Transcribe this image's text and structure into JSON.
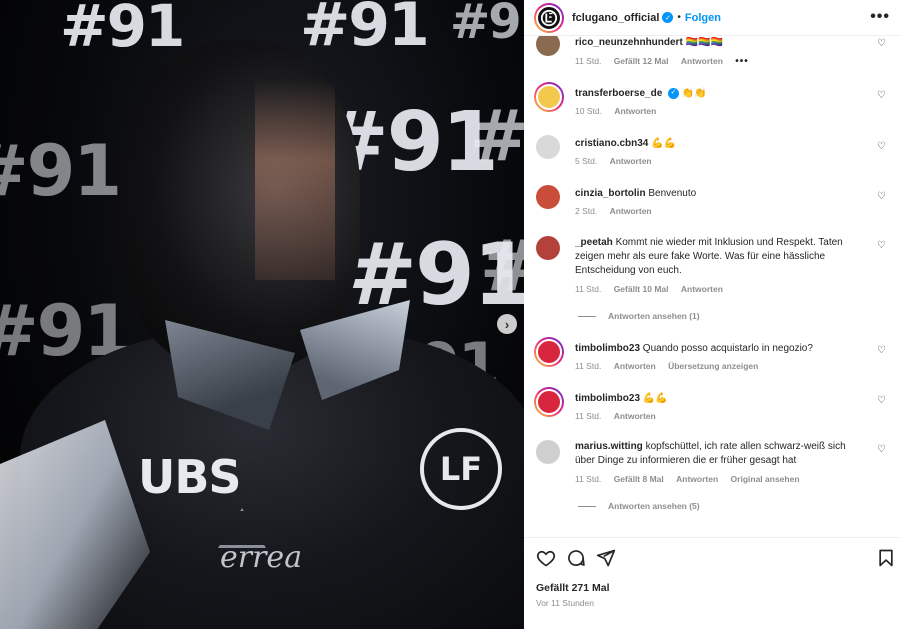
{
  "post": {
    "username": "fclugano_official",
    "verified": true,
    "separator": "•",
    "follow_label": "Folgen",
    "more_label": "•••",
    "likes": "Gefällt 271 Mal",
    "timestamp": "Vor 11 Stunden"
  },
  "photo": {
    "hashtags": [
      "#91",
      "#91",
      "#91",
      "#91",
      "#91",
      "#91",
      "#91",
      "#91",
      "#9",
      "#9"
    ],
    "sponsor_text": "UBS",
    "kit_brand": "errea",
    "badge_text": "LF",
    "next_icon": "›"
  },
  "comments": [
    {
      "user": "rico_neunzehnhundert",
      "text": "🏳️‍🌈🏳️‍🌈🏳️‍🌈",
      "time": "11 Std.",
      "likes": "Gefällt 12 Mal",
      "reply": "Antworten",
      "extra": "•••",
      "avatar_color": "#8a6b4f"
    },
    {
      "user": "transferboerse_de",
      "verified": true,
      "text": "👏👏",
      "time": "10 Std.",
      "reply": "Antworten",
      "avatar_color": "#f2c94c"
    },
    {
      "user": "cristiano.cbn34",
      "text": "💪💪",
      "time": "5 Std.",
      "reply": "Antworten",
      "avatar_color": "#d9d9d9"
    },
    {
      "user": "cinzia_bortolin",
      "text": "Benvenuto",
      "time": "2 Std.",
      "reply": "Antworten",
      "avatar_color": "#c94d3a"
    },
    {
      "user": "_peetah",
      "text": "Kommt nie wieder mit Inklusion und Respekt. Taten zeigen mehr als eure fake Worte. Was für eine hässliche Entscheidung von euch.",
      "time": "11 Std.",
      "likes": "Gefällt 10 Mal",
      "reply": "Antworten",
      "view_replies": "Antworten ansehen (1)",
      "avatar_color": "#b5423a"
    },
    {
      "user": "timbolimbo23",
      "text": "Quando posso acquistarlo in negozio?",
      "time": "11 Std.",
      "reply": "Antworten",
      "translate": "Übersetzung anzeigen",
      "avatar_color": "#d7263d"
    },
    {
      "user": "timbolimbo23",
      "text": "💪💪",
      "time": "11 Std.",
      "reply": "Antworten",
      "avatar_color": "#d7263d"
    },
    {
      "user": "marius.witting",
      "text": "kopfschüttel, ich rate allen schwarz-weiß sich über Dinge zu informieren die er früher gesagt hat",
      "time": "11 Std.",
      "likes": "Gefällt 8 Mal",
      "reply": "Antworten",
      "original": "Original ansehen",
      "view_replies": "Antworten ansehen (5)",
      "avatar_color": "#cfcfcf"
    }
  ],
  "icons": {
    "heart": "♡",
    "verified": "✓"
  },
  "colors": {
    "accent": "#0095f6",
    "meta": "#8e8e8e",
    "text": "#262626"
  }
}
